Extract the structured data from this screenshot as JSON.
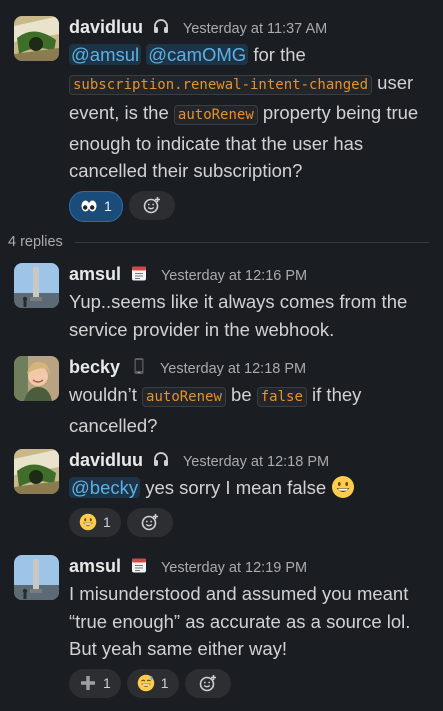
{
  "messages": [
    {
      "author": "davidluu",
      "status_icon": "headphones-icon",
      "time": "Yesterday at 11:37 AM",
      "parts": {
        "m1": "@amsul",
        "m2": "@camOMG",
        "t1": "for the",
        "c1": "subscription.renewal-intent-changed",
        "t2": "user event, is the",
        "c2": "autoRenew",
        "t3": "property being true enough to indicate that the user has cancelled their subscription?"
      },
      "reactions": [
        {
          "emoji": "eyes-emoji",
          "count": "1",
          "active": true
        }
      ]
    },
    {
      "author": "amsul",
      "status_icon": "calendar-icon",
      "time": "Yesterday at 12:16 PM",
      "text": "Yup..seems like it always comes from the service provider in the webhook."
    },
    {
      "author": "becky",
      "status_icon": "mobile-phone-icon",
      "time": "Yesterday at 12:18 PM",
      "parts": {
        "t1": "wouldn’t",
        "c1": "autoRenew",
        "t2": "be",
        "c2": "false",
        "t3": "if they cancelled?"
      }
    },
    {
      "author": "davidluu",
      "status_icon": "headphones-icon",
      "time": "Yesterday at 12:18 PM",
      "parts": {
        "m1": "@becky",
        "t1": "yes sorry I mean false"
      },
      "inline_emoji": "grinning-face-emoji",
      "reactions": [
        {
          "emoji": "grinning-face-emoji",
          "count": "1",
          "active": false
        }
      ]
    },
    {
      "author": "amsul",
      "status_icon": "calendar-icon",
      "time": "Yesterday at 12:19 PM",
      "text": "I misunderstood and assumed you meant “true enough” as accurate as a source lol. But yeah same either way!",
      "reactions": [
        {
          "emoji": "heavy-plus-emoji",
          "count": "1",
          "active": false
        },
        {
          "emoji": "sweat-smile-emoji",
          "count": "1",
          "active": false
        }
      ]
    }
  ],
  "replies_label": "4 replies",
  "colors": {
    "background": "#1a1d21",
    "mention_text": "#5db0e6",
    "code_text": "#e8912d",
    "active_reaction": "#1b4b79"
  }
}
